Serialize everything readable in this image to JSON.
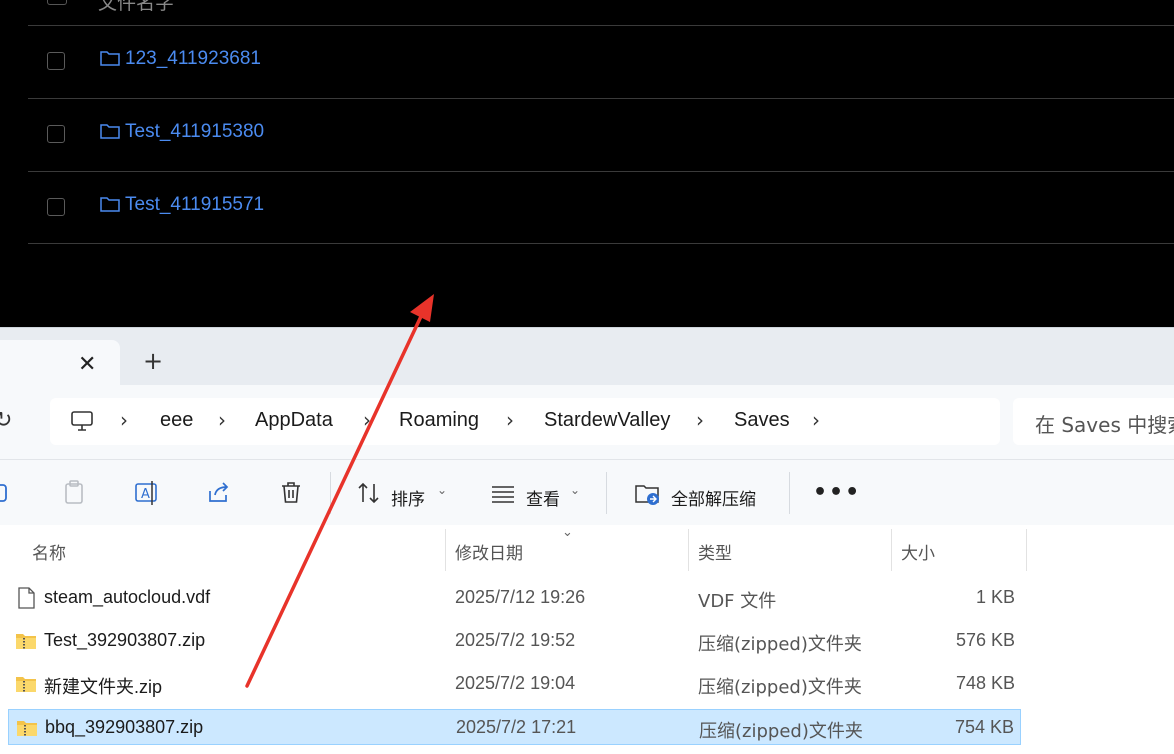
{
  "web_list": {
    "header_label": "文件名字",
    "rows": [
      {
        "name": "123_411923681"
      },
      {
        "name": "Test_411915380"
      },
      {
        "name": "Test_411915571"
      }
    ],
    "link_color": "#4b8bf0"
  },
  "explorer": {
    "tabs": {
      "close_glyph": "✕",
      "new_tab_glyph": "+"
    },
    "breadcrumb": [
      "eee",
      "AppData",
      "Roaming",
      "StardewValley",
      "Saves"
    ],
    "search_placeholder": "在 Saves 中搜索",
    "toolbar": {
      "sort_label": "排序",
      "view_label": "查看",
      "extract_label": "全部解压缩",
      "more_label": "•••"
    },
    "columns": {
      "name": "名称",
      "date": "修改日期",
      "type": "类型",
      "size": "大小"
    },
    "files": [
      {
        "name": "steam_autocloud.vdf",
        "date": "2025/7/12 19:26",
        "type": "VDF 文件",
        "size": "1 KB",
        "icon": "document-icon"
      },
      {
        "name": "Test_392903807.zip",
        "date": "2025/7/2 19:52",
        "type": "压缩(zipped)文件夹",
        "size": "576 KB",
        "icon": "zip-folder-icon"
      },
      {
        "name": "新建文件夹.zip",
        "date": "2025/7/2 19:04",
        "type": "压缩(zipped)文件夹",
        "size": "748 KB",
        "icon": "zip-folder-icon"
      },
      {
        "name": "bbq_392903807.zip",
        "date": "2025/7/2 17:21",
        "type": "压缩(zipped)文件夹",
        "size": "754 KB",
        "icon": "zip-folder-icon",
        "selected": true
      }
    ],
    "selection_color": "#cce8ff"
  },
  "annotation": {
    "arrow_color": "#e8332a"
  }
}
